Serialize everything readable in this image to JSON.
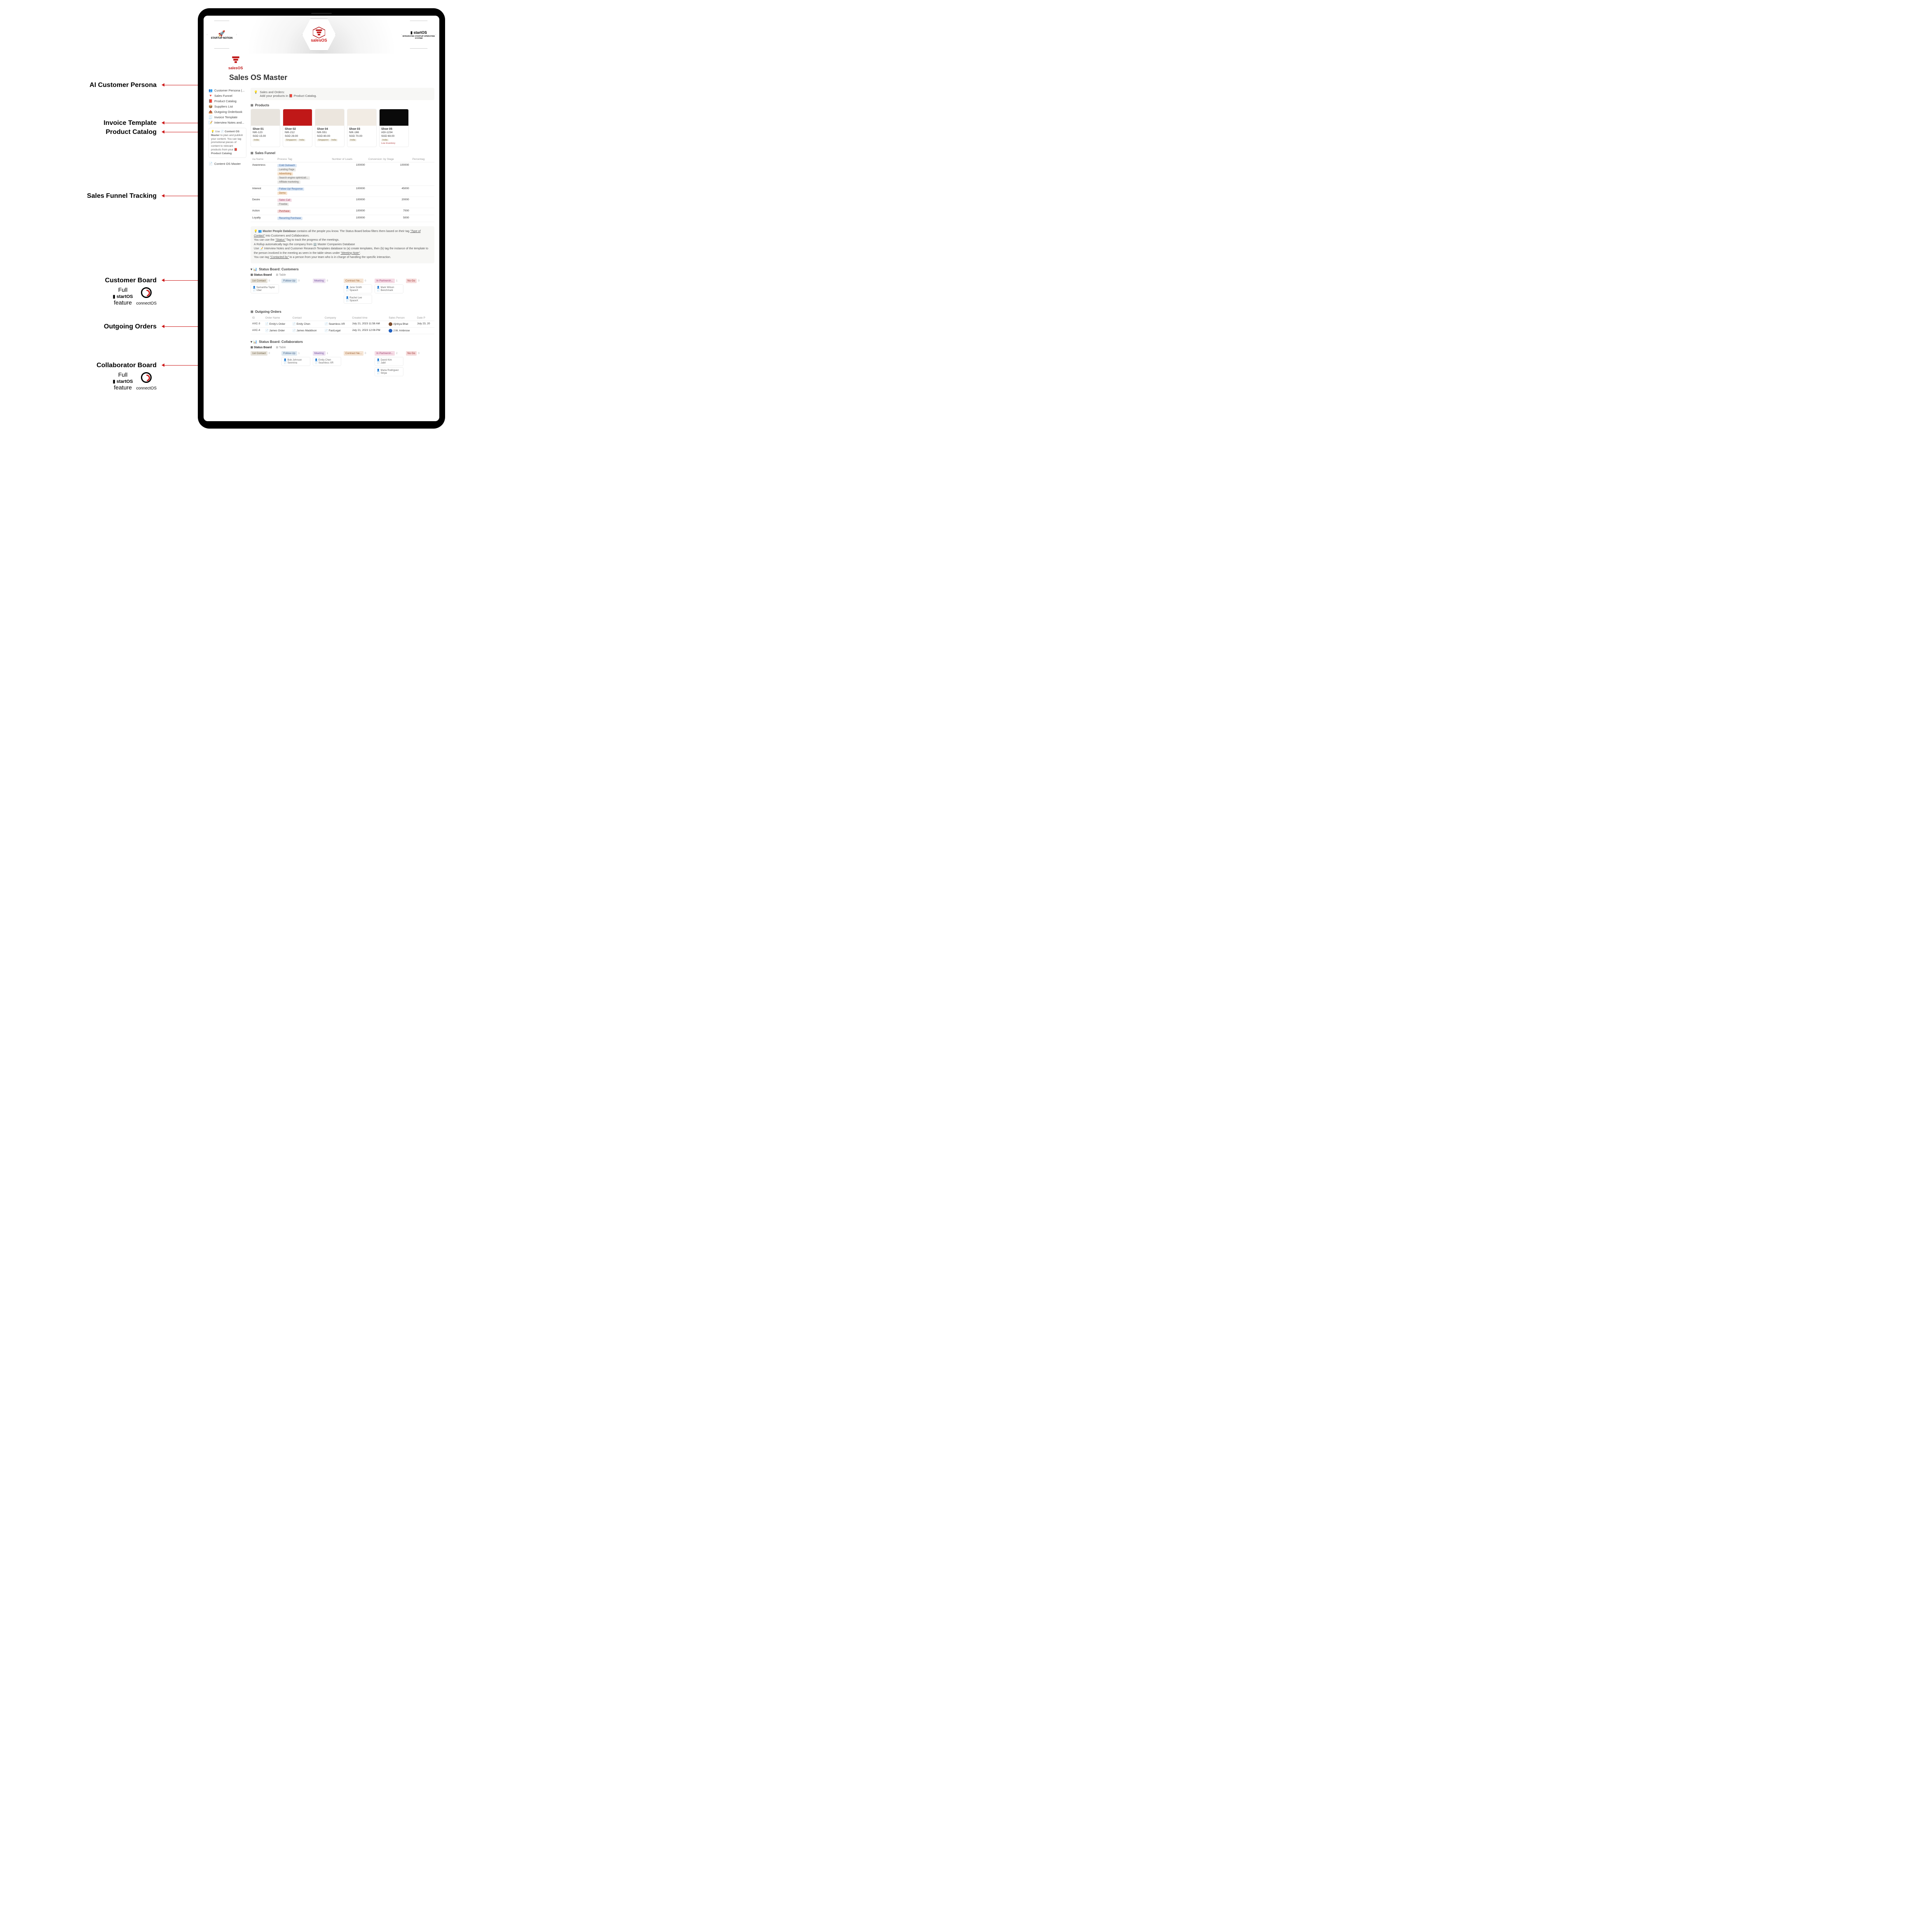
{
  "labels": {
    "persona": "AI Customer Persona",
    "invoice": "Invoice Template",
    "catalog": "Product Catalog",
    "funnel": "Sales Funnel Tracking",
    "customers": "Customer Board",
    "orders": "Outgoing Orders",
    "collab": "Collaborator Board",
    "full_feature": "Full",
    "startos": "startOS",
    "feature": "feature",
    "connectos": "connectOS"
  },
  "banner": {
    "left": "STARTUP NOTION",
    "center": "salesOS",
    "right_title": "startOS",
    "right_sub": "INTEGRATED STARTUP OPERATING SYSTEM"
  },
  "page_title": "Sales OS Master",
  "sidebar": {
    "items": [
      {
        "emoji": "👥",
        "label": "Customer Persona (..."
      },
      {
        "emoji": "🔻",
        "label": "Sales Funnel"
      },
      {
        "emoji": "📕",
        "label": "Product Catalog"
      },
      {
        "emoji": "📦",
        "label": "Suppliers List"
      },
      {
        "emoji": "📤",
        "label": "Outgoing Orderbook"
      },
      {
        "emoji": "🧾",
        "label": "Invoice Template"
      },
      {
        "emoji": "📝",
        "label": "Interview Notes and..."
      }
    ],
    "tip_prefix": "Use 📄 ",
    "tip_b1": "Content OS Master",
    "tip_mid": " to plan and publish your content. You can tag promotional pieces of content to relevant products from your ",
    "tip_b2": "📕 Product Catalog",
    "master_link": "Content OS Master"
  },
  "callout": {
    "emoji": "💡",
    "line1": "Sales and Orders:",
    "line2": "Add your products in 📕 Product Catalog."
  },
  "products": {
    "heading": "Products",
    "items": [
      {
        "name": "Shoe 01",
        "sku": "NIK-123",
        "price": "SGD 15.00",
        "tags": [
          "India"
        ],
        "bg": "#e8e4de"
      },
      {
        "name": "Shoe 02",
        "sku": "NIK-212",
        "price": "SGD 29.00",
        "tags": [
          "Singapore",
          "India"
        ],
        "bg": "#c01818"
      },
      {
        "name": "Shoe 04",
        "sku": "NIK-551",
        "price": "SGD 80.00",
        "tags": [
          "Singapore",
          "India"
        ],
        "bg": "#ece6de"
      },
      {
        "name": "Shoe  03",
        "sku": "NIK-166",
        "price": "SGD 70.00",
        "tags": [
          "India"
        ],
        "bg": "#f2ece4"
      },
      {
        "name": "Shoe 05",
        "sku": "ADI-1234",
        "price": "SGD 69.00",
        "tags": [
          "India"
        ],
        "low": "Low Inventory",
        "bg": "#0a0a0a"
      }
    ]
  },
  "funnel": {
    "heading": "Sales Funnel",
    "cols": [
      "Aa Name",
      "Process Tag",
      "Number of Leads",
      "Conversion: by Stage",
      "Percentag"
    ],
    "rows": [
      {
        "name": "Awareness",
        "tags": [
          [
            "Cold Outreach",
            "blue"
          ],
          [
            "Landing Page",
            "gray"
          ],
          [
            "Advertising",
            "orange"
          ],
          [
            "Search engine optimizati...",
            "gray"
          ],
          [
            "Affiliate marketing",
            "gray"
          ]
        ],
        "leads": "100000",
        "conv": "100000"
      },
      {
        "name": "Interest",
        "tags": [
          [
            "Follow-Up/ Response",
            "blue"
          ],
          [
            "Demo",
            "orange"
          ]
        ],
        "leads": "100000",
        "conv": "45000"
      },
      {
        "name": "Desire",
        "tags": [
          [
            "Sales Call",
            "pink"
          ],
          [
            "Freebie",
            "gray"
          ]
        ],
        "leads": "100000",
        "conv": "20000"
      },
      {
        "name": "Action",
        "tags": [
          [
            "Purchase",
            "red"
          ]
        ],
        "leads": "100000",
        "conv": "7000"
      },
      {
        "name": "Loyalty",
        "tags": [
          [
            "Recurring Purchase",
            "blue"
          ]
        ],
        "leads": "100000",
        "conv": "5000"
      }
    ]
  },
  "info": {
    "l1a": "👥 Master People Database",
    "l1b": " contains all the people you know. The Status Board below filters them based on their tag ",
    "l1c": "\"Type of Contact\"",
    "l1d": " into Customers and Collaborators.",
    "l2a": "You can use the ",
    "l2b": "\"Status\"",
    "l2c": " Tag to track the progress of the meetings.",
    "l3": "A Rollup automatically tags the company from 🏢 Master Companies Database",
    "l4a": "Use 📝 Interview Notes and Customer Research Templates database to (a) create templates, then (b) tag the instance of the template to the person involved in the meeting as seen in the table views under ",
    "l4b": "\"Meeting Note\"",
    "l4c": ".",
    "l5a": "You can tag ",
    "l5b": "\"Contacted by\"",
    "l5c": " to a person from your team who is in charge of handling the specific interaction."
  },
  "board_customers": {
    "heading": "Status Board: Customers",
    "tab1": "Status Board",
    "tab2": "Table",
    "cols": [
      {
        "label": "1st Contact",
        "c": "c1",
        "count": "0",
        "cards": [
          {
            "name": "Samantha Taylor",
            "sub": "Uber"
          }
        ]
      },
      {
        "label": "Follow-Up",
        "c": "c2",
        "count": "0",
        "cards": []
      },
      {
        "label": "Meeting",
        "c": "c3",
        "count": "0",
        "cards": []
      },
      {
        "label": "Contract Ne...",
        "c": "c4",
        "count": "0",
        "cards": [
          {
            "name": "Jane Smith",
            "sub": "SpaceX"
          },
          {
            "name": "Rachel Lee",
            "sub": "SpaceX"
          }
        ]
      },
      {
        "label": "In Partnersh...",
        "c": "c5",
        "count": "1",
        "cards": [
          {
            "name": "Mark Wilson",
            "sub": "Benchmark"
          }
        ]
      },
      {
        "label": "No Go",
        "c": "c6",
        "count": "0",
        "cards": []
      }
    ]
  },
  "orders": {
    "heading": "Outgoing Orders",
    "cols": [
      "ID",
      "Order Name",
      "Contact",
      "Company",
      "Created time",
      "Sales Person",
      "Date P"
    ],
    "rows": [
      {
        "id": "AXC-3",
        "name": "Emily's Order",
        "contact": "Emily Chen",
        "company": "Seamless XR",
        "created": "July 21, 2023 11:58 AM",
        "person": "Ajinkya Bhat",
        "pcolor": "#7a4a2a",
        "date": "July 23, 20"
      },
      {
        "id": "AXC-4",
        "name": "James Order",
        "contact": "James Maddison",
        "company": "FastLegal",
        "created": "July 21, 2023 12:06 PM",
        "person": "J.W. Ambrose",
        "pcolor": "#2060c0",
        "date": ""
      }
    ]
  },
  "board_collab": {
    "heading": "Status Board: Collaborators",
    "tab1": "Status Board",
    "tab2": "Table",
    "cols": [
      {
        "label": "1st Contact",
        "c": "c1",
        "count": "0",
        "cards": []
      },
      {
        "label": "Follow-Up",
        "c": "c2",
        "count": "1",
        "cards": [
          {
            "name": "Bob Johnson",
            "sub": "Senmina"
          }
        ]
      },
      {
        "label": "Meeting",
        "c": "c3",
        "count": "1",
        "cards": [
          {
            "name": "Emily Chen",
            "sub": "Seamless XR"
          }
        ]
      },
      {
        "label": "Contract Ne...",
        "c": "c4",
        "count": "0",
        "cards": []
      },
      {
        "label": "In Partnersh...",
        "c": "c5",
        "count": "2",
        "cards": [
          {
            "name": "David Kim",
            "sub": "Jabil"
          },
          {
            "name": "Maria Rodriguez",
            "sub": "Stripe"
          }
        ]
      },
      {
        "label": "No Go",
        "c": "c6",
        "count": "0",
        "cards": []
      }
    ]
  }
}
